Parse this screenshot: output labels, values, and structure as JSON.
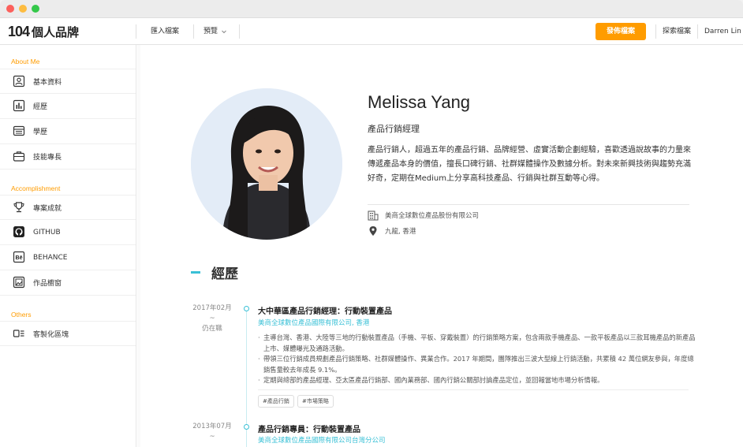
{
  "nav": {
    "logo_number": "104",
    "logo_text": "個人品牌",
    "import_label": "匯入檔案",
    "preview_label": "預覽",
    "publish_label": "發佈檔案",
    "search_label": "探索檔案",
    "user_name": "Darren Lin"
  },
  "sidebar": {
    "sections": [
      {
        "title": "About Me",
        "items": [
          {
            "label": "基本資料",
            "icon": "profile-icon"
          },
          {
            "label": "經歷",
            "icon": "bar-chart-icon"
          },
          {
            "label": "學歷",
            "icon": "education-icon"
          },
          {
            "label": "技能專長",
            "icon": "briefcase-icon"
          }
        ]
      },
      {
        "title": "Accomplishment",
        "items": [
          {
            "label": "專案成就",
            "icon": "trophy-icon"
          },
          {
            "label": "GITHUB",
            "icon": "github-icon"
          },
          {
            "label": "BEHANCE",
            "icon": "behance-icon"
          },
          {
            "label": "作品櫥窗",
            "icon": "portfolio-icon"
          }
        ]
      },
      {
        "title": "Others",
        "items": [
          {
            "label": "客製化區塊",
            "icon": "custom-block-icon"
          }
        ]
      }
    ]
  },
  "profile": {
    "name": "Melissa Yang",
    "role": "產品行銷經理",
    "bio": "產品行銷人，超過五年的產品行銷、品牌經營、虛實活動企劃經驗，喜歡透過說故事的力量來傳遞產品本身的價值，擅長口碑行銷、社群媒體操作及數據分析。對未來新興技術與趨勢充滿好奇，定期在Medium上分享高科技產品、行銷與社群互動等心得。",
    "company": "美商全球數位產品股份有限公司",
    "location": "九龍, 香港"
  },
  "experience": {
    "section_title": "經歷",
    "jobs": [
      {
        "date": "2017年02月",
        "tilde": "~",
        "end": "仍在職",
        "title": "大中華區產品行銷經理：行動裝置產品",
        "company": "美商全球數位產品國際有限公司, 香港",
        "bullets": [
          "主導台灣、香港、大陸等三地的行動裝置產品（手機、平板、穿戴裝置）的行銷策略方案，包含兩款手機產品、一款平板產品以三款耳機產品的新產品上市、媒體曝光及通路活動。",
          "帶領三位行銷成員規劃產品行銷策略、社群媒體操作、異業合作。2017 年期間，團隊推出三波大型線上行銷活動，共累積 42 萬位網友參與，年度總銷售量較去年成長 9.1%。",
          "定期與總部的產品經理、亞太區產品行銷部、國內業務部、國內行銷公關部討論產品定位，並回報當地市場分析情報。"
        ],
        "tags": [
          "#產品行銷",
          "#市場策略"
        ]
      },
      {
        "date": "2013年07月",
        "tilde": "~",
        "title": "產品行銷專員：行動裝置產品",
        "company": "美商全球數位產品國際有限公司台灣分公司"
      }
    ]
  }
}
